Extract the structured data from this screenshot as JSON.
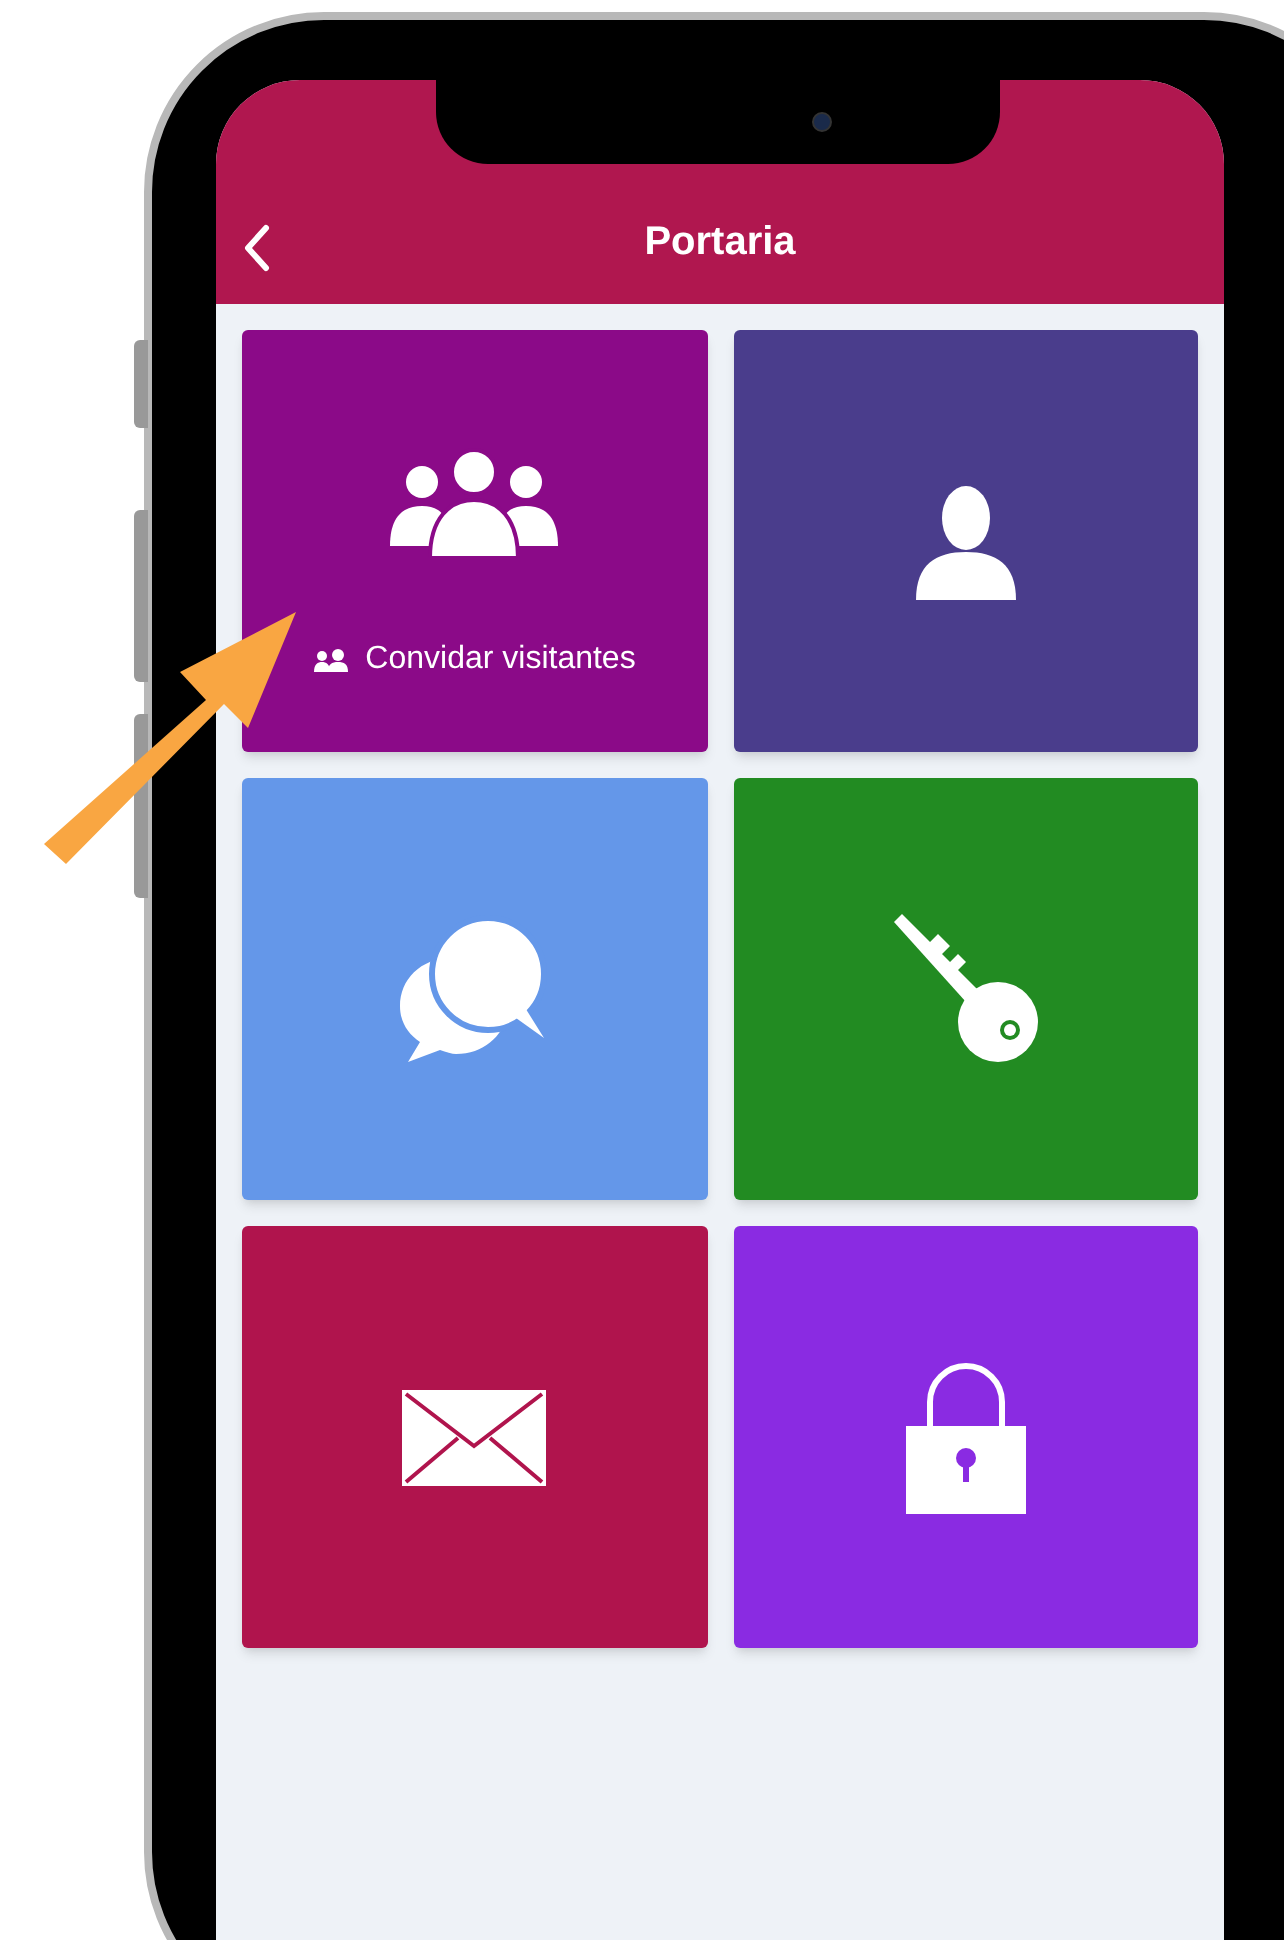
{
  "header": {
    "title": "Portaria"
  },
  "tiles": [
    {
      "kind": "group",
      "color": "#8b0a88",
      "label": "Convidar visitantes"
    },
    {
      "kind": "person",
      "color": "#4a3d8c"
    },
    {
      "kind": "chat",
      "color": "#6497e9"
    },
    {
      "kind": "key",
      "color": "#228b22"
    },
    {
      "kind": "mail",
      "color": "#b0144d"
    },
    {
      "kind": "lock",
      "color": "#8a2be2"
    }
  ]
}
